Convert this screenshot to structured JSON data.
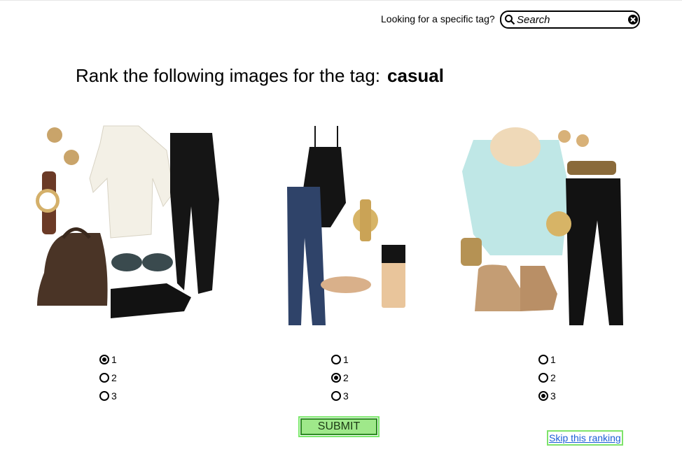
{
  "search": {
    "label": "Looking for a specific tag?",
    "placeholder": "Search"
  },
  "heading": {
    "prefix": "Rank the following images for the tag:",
    "tag": "casual"
  },
  "outfits": [
    {
      "selected_rank": 1,
      "options": [
        "1",
        "2",
        "3"
      ]
    },
    {
      "selected_rank": 2,
      "options": [
        "1",
        "2",
        "3"
      ]
    },
    {
      "selected_rank": 3,
      "options": [
        "1",
        "2",
        "3"
      ]
    }
  ],
  "actions": {
    "submit_label": "SUBMIT",
    "skip_label": "Skip this ranking"
  },
  "colors": {
    "submit_bg": "#9fe88a",
    "submit_border": "#2e8a24",
    "skip_border": "#7fe36b",
    "link": "#1b5fd6"
  }
}
